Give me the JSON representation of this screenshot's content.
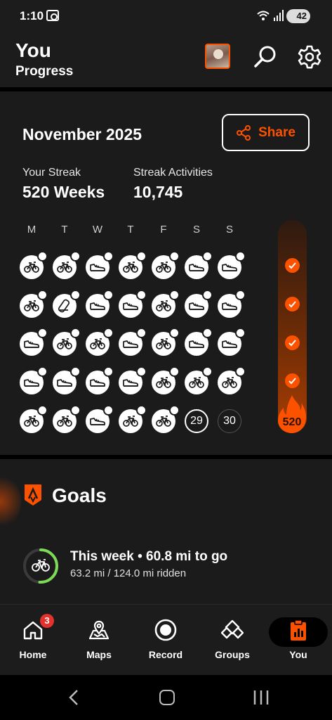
{
  "status_bar": {
    "time": "1:10",
    "battery": "42"
  },
  "header": {
    "title": "You",
    "subtitle": "Progress"
  },
  "streak": {
    "month": "November 2025",
    "share_label": "Share",
    "streak_label": "Your Streak",
    "streak_value": "520 Weeks",
    "activities_label": "Streak Activities",
    "activities_value": "10,745",
    "weekdays": [
      "M",
      "T",
      "W",
      "T",
      "F",
      "S",
      "S"
    ],
    "weeks": [
      [
        "bike",
        "bike",
        "shoe",
        "bike",
        "bike",
        "shoe",
        "shoe"
      ],
      [
        "bike",
        "weights",
        "shoe",
        "shoe",
        "bike",
        "shoe",
        "shoe"
      ],
      [
        "shoe",
        "bike",
        "bike",
        "shoe",
        "bike",
        "shoe",
        "shoe"
      ],
      [
        "shoe",
        "shoe",
        "shoe",
        "shoe",
        "bike",
        "bike",
        "bike"
      ],
      [
        "bike",
        "bike",
        "shoe",
        "bike",
        "bike",
        "29",
        "30"
      ]
    ],
    "week_count": "520",
    "accent_color": "#fc5200"
  },
  "goals": {
    "title": "Goals",
    "week_goal": "This week • 60.8 mi to go",
    "week_detail": "63.2 mi / 124.0 mi ridden",
    "progress": 0.51,
    "ring_color": "#7ed957"
  },
  "nav": {
    "home": "Home",
    "home_badge": "3",
    "maps": "Maps",
    "record": "Record",
    "groups": "Groups",
    "you": "You"
  }
}
